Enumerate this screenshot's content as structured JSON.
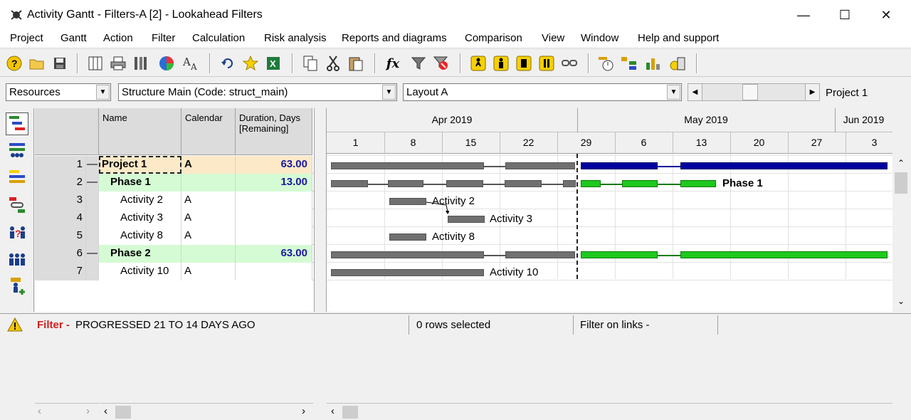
{
  "window": {
    "title": "Activity Gantt - Filters-A [2] - Lookahead Filters",
    "minimize": "—",
    "maximize": "☐",
    "close": "✕"
  },
  "menu": [
    "Project",
    "Gantt",
    "Action",
    "Filter",
    "Calculation",
    "Risk analysis",
    "Reports and diagrams",
    "Comparison",
    "View",
    "Window",
    "Help and support"
  ],
  "toolbar_icons": [
    "help-icon",
    "open-folder-icon",
    "save-icon",
    "table-icon",
    "print-icon",
    "tools-icon",
    "pie-chart-icon",
    "font-size-icon",
    "undo-icon",
    "star-icon",
    "excel-icon",
    "copy-icon",
    "cut-icon",
    "paste-icon",
    "function-icon",
    "filter-icon",
    "clear-filter-icon",
    "person-run-icon",
    "person-icon",
    "person-pause-icon",
    "person-hold-icon",
    "link-icon",
    "schedule-icon",
    "hierarchy-icon",
    "resource-chart-icon",
    "cost-icon"
  ],
  "combos": {
    "resources": "Resources",
    "structure": "Structure Main (Code: struct_main)",
    "layout": "Layout A",
    "project_label": "Project 1"
  },
  "grid": {
    "headers": {
      "name": "Name",
      "calendar": "Calendar",
      "duration": "Duration, Days [Remaining]"
    },
    "rows": [
      {
        "num": "1",
        "toggle": "—",
        "name": "Project 1",
        "calendar": "A",
        "duration": "63.00",
        "level": 0
      },
      {
        "num": "2",
        "toggle": "—",
        "name": "Phase 1",
        "calendar": "",
        "duration": "13.00",
        "level": 1
      },
      {
        "num": "3",
        "toggle": "",
        "name": "Activity 2",
        "calendar": "A",
        "duration": "",
        "level": 2
      },
      {
        "num": "4",
        "toggle": "",
        "name": "Activity 3",
        "calendar": "A",
        "duration": "",
        "level": 2
      },
      {
        "num": "5",
        "toggle": "",
        "name": "Activity 8",
        "calendar": "A",
        "duration": "",
        "level": 2
      },
      {
        "num": "6",
        "toggle": "—",
        "name": "Phase 2",
        "calendar": "",
        "duration": "63.00",
        "level": 1
      },
      {
        "num": "7",
        "toggle": "",
        "name": "Activity 10",
        "calendar": "A",
        "duration": "",
        "level": 2
      }
    ]
  },
  "timeline": {
    "months": [
      "Apr 2019",
      "May 2019",
      "Jun 2019"
    ],
    "days": [
      "1",
      "8",
      "15",
      "22",
      "29",
      "6",
      "13",
      "20",
      "27",
      "3"
    ]
  },
  "gantt_labels": {
    "phase1": "Phase 1",
    "a2": "Activity 2",
    "a3": "Activity 3",
    "a8": "Activity 8",
    "a10": "Activity 10"
  },
  "status": {
    "filter_prefix": "Filter -",
    "filter_text": "PROGRESSED 21 TO 14 DAYS AGO",
    "rows_selected": "0 rows selected",
    "filter_links": "Filter on links -"
  },
  "colors": {
    "summary_blue": "#00009c",
    "phase_green": "#1ec81e",
    "progress_grey": "#707070",
    "row_selected": "#fbe9c8",
    "phase_row": "#d4fbd4"
  }
}
